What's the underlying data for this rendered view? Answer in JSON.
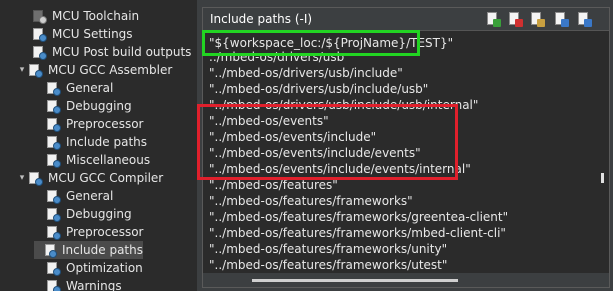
{
  "tree": [
    {
      "label": "MCU Toolchain",
      "level": 1,
      "twisty": "",
      "icon": "tool-icon",
      "selected": false
    },
    {
      "label": "MCU Settings",
      "level": 1,
      "twisty": "",
      "icon": "settings-page-icon",
      "selected": false
    },
    {
      "label": "MCU Post build outputs",
      "level": 1,
      "twisty": "",
      "icon": "settings-page-icon",
      "selected": false
    },
    {
      "label": "MCU GCC Assembler",
      "level": 0,
      "twisty": "▾",
      "icon": "settings-page-icon",
      "selected": false
    },
    {
      "label": "General",
      "level": 2,
      "twisty": "",
      "icon": "settings-page-icon",
      "selected": false
    },
    {
      "label": "Debugging",
      "level": 2,
      "twisty": "",
      "icon": "settings-page-icon",
      "selected": false
    },
    {
      "label": "Preprocessor",
      "level": 2,
      "twisty": "",
      "icon": "settings-page-icon",
      "selected": false
    },
    {
      "label": "Include paths",
      "level": 2,
      "twisty": "",
      "icon": "settings-page-icon",
      "selected": false
    },
    {
      "label": "Miscellaneous",
      "level": 2,
      "twisty": "",
      "icon": "settings-page-icon",
      "selected": false
    },
    {
      "label": "MCU GCC Compiler",
      "level": 0,
      "twisty": "▾",
      "icon": "settings-page-icon",
      "selected": false
    },
    {
      "label": "General",
      "level": 2,
      "twisty": "",
      "icon": "settings-page-icon",
      "selected": false
    },
    {
      "label": "Debugging",
      "level": 2,
      "twisty": "",
      "icon": "settings-page-icon",
      "selected": false
    },
    {
      "label": "Preprocessor",
      "level": 2,
      "twisty": "",
      "icon": "settings-page-icon",
      "selected": false
    },
    {
      "label": "Include paths",
      "level": 2,
      "twisty": "",
      "icon": "settings-page-icon",
      "selected": true
    },
    {
      "label": "Optimization",
      "level": 2,
      "twisty": "",
      "icon": "settings-page-icon",
      "selected": false
    },
    {
      "label": "Warnings",
      "level": 2,
      "twisty": "",
      "icon": "settings-page-icon",
      "selected": false
    }
  ],
  "panel": {
    "title": "Include paths (-I)",
    "toolbar": [
      {
        "name": "add-path-icon",
        "mark_color": "#3aa03a"
      },
      {
        "name": "delete-path-icon",
        "mark_color": "#d03030"
      },
      {
        "name": "edit-path-icon",
        "mark_color": "#c8a040"
      },
      {
        "name": "move-up-icon",
        "mark_color": "#3a78c8"
      },
      {
        "name": "move-down-icon",
        "mark_color": "#3a78c8"
      }
    ],
    "paths": [
      "\"${workspace_loc:/${ProjName}/TEST}\"",
      "../mbed-os/drivers/usb",
      "\"../mbed-os/drivers/usb/include\"",
      "\"../mbed-os/drivers/usb/include/usb\"",
      "\"../mbed-os/drivers/usb/include/usb/internal\"",
      "\"../mbed-os/events\"",
      "\"../mbed-os/events/include\"",
      "\"../mbed-os/events/include/events\"",
      "\"../mbed-os/events/include/events/internal\"",
      "\"../mbed-os/features\"",
      "\"../mbed-os/features/frameworks\"",
      "\"../mbed-os/features/frameworks/greentea-client\"",
      "\"../mbed-os/features/frameworks/mbed-client-cli\"",
      "\"../mbed-os/features/frameworks/unity\"",
      "\"../mbed-os/features/frameworks/utest\""
    ]
  },
  "highlight_colors": {
    "green": "#22d422",
    "red": "#e0202c"
  }
}
